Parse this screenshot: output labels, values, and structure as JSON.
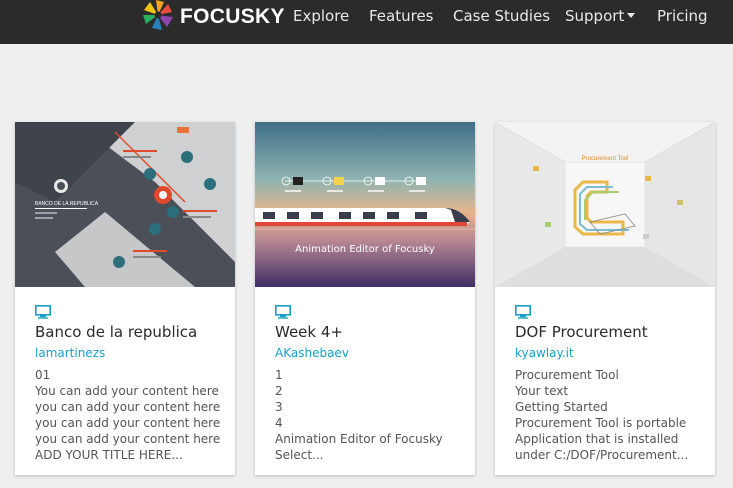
{
  "header": {
    "brand": "FOCUSKY",
    "nav": [
      {
        "label": "Explore"
      },
      {
        "label": "Features"
      },
      {
        "label": "Case Studies"
      },
      {
        "label": "Support"
      },
      {
        "label": "Pricing"
      }
    ]
  },
  "cards": [
    {
      "title": "Banco de la republica",
      "author": "lamartinezs",
      "thumb": {
        "banner": "BANCO DE LA REPUBLICA"
      },
      "lines": [
        "01",
        "You can add your content here",
        "you can add your content here",
        "you can add your content here",
        "you can add your content here",
        "ADD YOUR TITLE HERE..."
      ]
    },
    {
      "title": "Week 4+",
      "author": "AKashebaev",
      "thumb": {
        "caption": "Animation Editor of Focusky"
      },
      "lines": [
        "1",
        "2",
        "3",
        "4",
        "Animation Editor of Focusky",
        "Select..."
      ]
    },
    {
      "title": "DOF Procurement",
      "author": "kyawlay.it",
      "thumb": {
        "caption": "Procurement Tool"
      },
      "lines": [
        "Procurement Tool",
        "Your text",
        "Getting Started",
        "Procurement Tool is portable",
        "Application that is installed",
        "under C:/DOF/Procurement..."
      ]
    }
  ],
  "colors": {
    "header_bg": "#2b2b2b",
    "page_bg": "#efefef",
    "author_link": "#1aa0c8",
    "device_icon": "#1aa0c8"
  },
  "icons": [
    "focusky-logo-icon",
    "caret-down-icon",
    "monitor-icon"
  ]
}
